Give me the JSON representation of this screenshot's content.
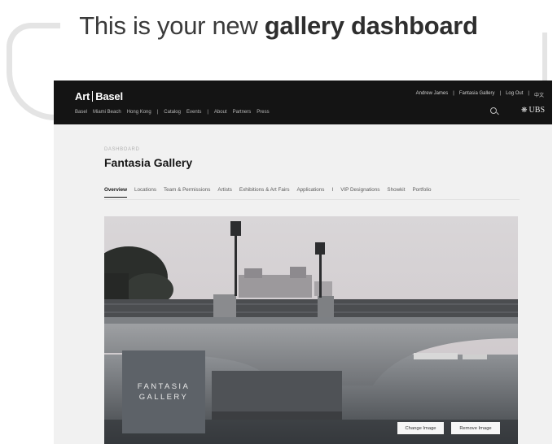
{
  "headline": {
    "prefix": "This is your new",
    "bold": "gallery dashboard"
  },
  "brand": {
    "logo_left": "Art",
    "logo_right": "Basel"
  },
  "city_nav": [
    "Basel",
    "Miami Beach",
    "Hong Kong",
    "|",
    "Catalog",
    "Events",
    "|",
    "About",
    "Partners",
    "Press"
  ],
  "account_nav": [
    "Andrew James",
    "|",
    "Fantasia Gallery",
    "|",
    "Log Out",
    "|",
    "中文"
  ],
  "sponsor": {
    "name": "UBS"
  },
  "dashboard": {
    "crumb": "DASHBOARD",
    "title": "Fantasia Gallery",
    "tabs": [
      "Overview",
      "Locations",
      "Team & Permissions",
      "Artists",
      "Exhibitions & Art Fairs",
      "Applications",
      "I",
      "VIP Designations",
      "Showkit",
      "Portfolio"
    ],
    "active_tab": "Overview"
  },
  "hero": {
    "logo_line1": "FANTASIA",
    "logo_line2": "GALLERY",
    "change_label": "Change Image",
    "remove_label": "Remove Image"
  },
  "colors": {
    "topbar": "#141414",
    "tile": "#5d6268",
    "canvas": "#f1f1f1"
  }
}
